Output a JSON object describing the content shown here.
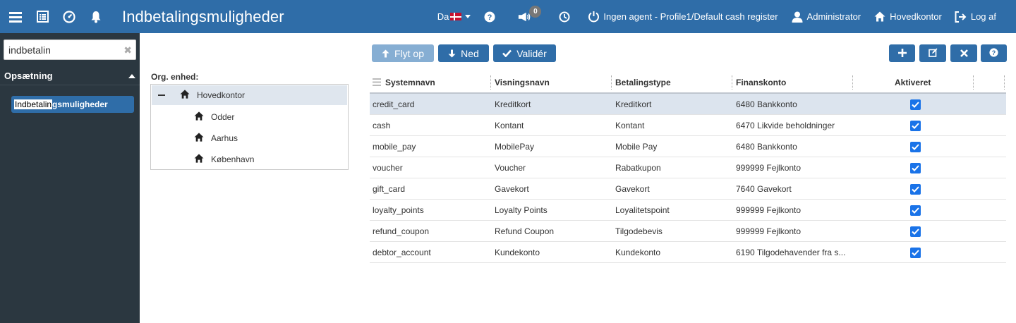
{
  "header": {
    "title": "Indbetalingsmuligheder",
    "language": "Da",
    "notification_count": "0",
    "agent_status": "Ingen agent - Profile1/Default cash register",
    "user": "Administrator",
    "location": "Hovedkontor",
    "logout": "Log af",
    "colors": {
      "bar": "#2f6da8"
    }
  },
  "sidebar": {
    "search_value": "indbetalin",
    "section_title": "Opsætning",
    "item_match": "Indbetalin",
    "item_rest": "gsmuligheder"
  },
  "org": {
    "label": "Org. enhed:",
    "root": "Hovedkontor",
    "children": [
      "Odder",
      "Aarhus",
      "København"
    ]
  },
  "toolbar": {
    "move_up": "Flyt op",
    "move_down": "Ned",
    "validate": "Validér"
  },
  "grid": {
    "columns": [
      "Systemnavn",
      "Visningsnavn",
      "Betalingstype",
      "Finanskonto",
      "Aktiveret"
    ],
    "rows": [
      [
        "credit_card",
        "Kreditkort",
        "Kreditkort",
        "6480 Bankkonto"
      ],
      [
        "cash",
        "Kontant",
        "Kontant",
        "6470 Likvide beholdninger"
      ],
      [
        "mobile_pay",
        "MobilePay",
        "Mobile Pay",
        "6480 Bankkonto"
      ],
      [
        "voucher",
        "Voucher",
        "Rabatkupon",
        "999999 Fejlkonto"
      ],
      [
        "gift_card",
        "Gavekort",
        "Gavekort",
        "7640 Gavekort"
      ],
      [
        "loyalty_points",
        "Loyalty Points",
        "Loyalitetspoint",
        "999999 Fejlkonto"
      ],
      [
        "refund_coupon",
        "Refund Coupon",
        "Tilgodebevis",
        "999999 Fejlkonto"
      ],
      [
        "debtor_account",
        "Kundekonto",
        "Kundekonto",
        "6190 Tilgodehavender fra s..."
      ]
    ]
  }
}
